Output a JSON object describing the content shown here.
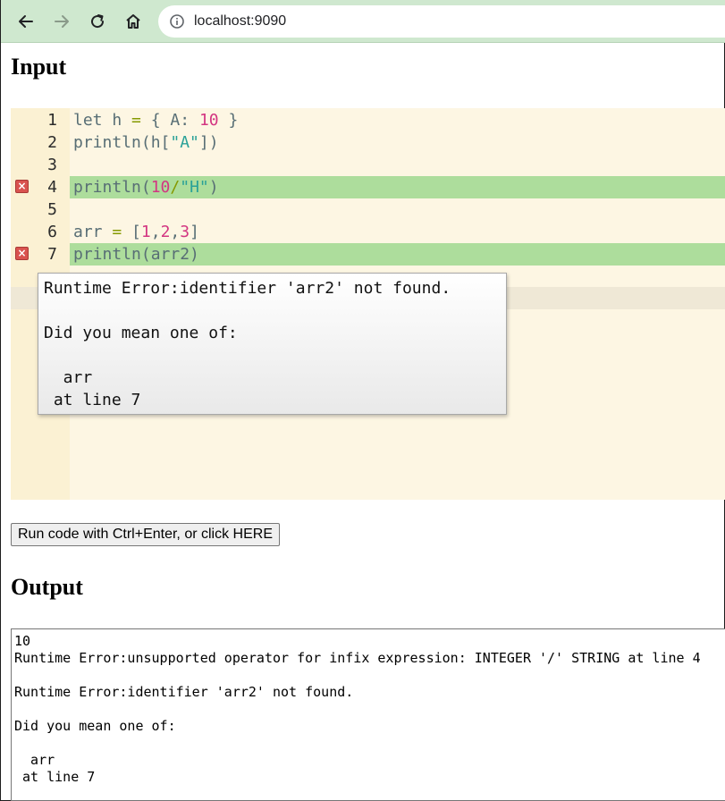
{
  "browser": {
    "url": "localhost:9090"
  },
  "input_heading": "Input",
  "output_heading": "Output",
  "editor": {
    "lines": [
      {
        "num": "1",
        "error": false
      },
      {
        "num": "2",
        "error": false
      },
      {
        "num": "3",
        "error": false
      },
      {
        "num": "4",
        "error": true
      },
      {
        "num": "5",
        "error": false
      },
      {
        "num": "6",
        "error": false
      },
      {
        "num": "7",
        "error": true
      }
    ],
    "error_marker_glyph": "×",
    "tooltip": "Runtime Error:identifier 'arr2' not found.\n\nDid you mean one of:\n\n  arr\n at line 7"
  },
  "run_button_label": "Run code with Ctrl+Enter, or click HERE",
  "output_text": "10\nRuntime Error:unsupported operator for infix expression: INTEGER '/' STRING at line 4\n\nRuntime Error:identifier 'arr2' not found.\n\nDid you mean one of:\n\n  arr\n at line 7",
  "colors": {
    "toolbar": "#cfe8cf",
    "editor_bg": "#fdf6e3",
    "error_line": "#addd9c",
    "error_marker": "#d9534f"
  }
}
